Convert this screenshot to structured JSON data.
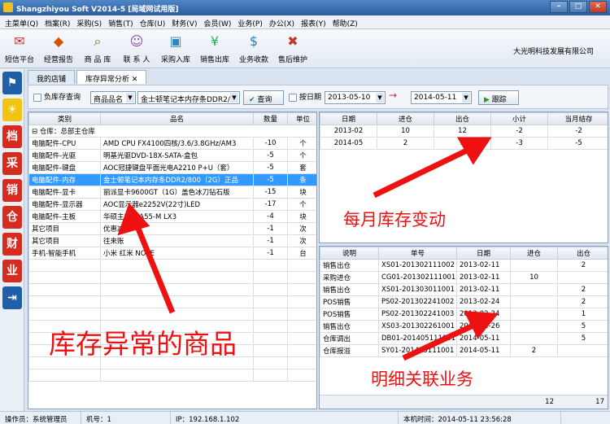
{
  "title": "Shangzhiyou Soft V2014-5 [局域网试用版]",
  "menu": [
    "主菜单(Q)",
    "档案(R)",
    "采购(S)",
    "销售(T)",
    "仓库(U)",
    "财务(V)",
    "会员(W)",
    "业务(P)",
    "办公(X)",
    "报表(Y)",
    "帮助(Z)"
  ],
  "toolbar": [
    {
      "label": "短信平台",
      "icon": "envelope-icon",
      "color": "#c0392b",
      "glyph": "✉"
    },
    {
      "label": "经营报告",
      "icon": "hat-icon",
      "color": "#d35400",
      "glyph": "◆"
    },
    {
      "label": "商 品 库",
      "icon": "magnifier-icon",
      "color": "#7f6a2a",
      "glyph": "⌕"
    },
    {
      "label": "联 系 人",
      "icon": "person-icon",
      "color": "#8e44ad",
      "glyph": "☺"
    },
    {
      "label": "采购入库",
      "icon": "box-icon",
      "color": "#2e86c1",
      "glyph": "▣"
    },
    {
      "label": "销售出库",
      "icon": "money-icon",
      "color": "#27ae60",
      "glyph": "¥"
    },
    {
      "label": "业务收款",
      "icon": "dollar-icon",
      "color": "#2980b9",
      "glyph": "$"
    },
    {
      "label": "售后维护",
      "icon": "tools-icon",
      "color": "#c0392b",
      "glyph": "✖"
    }
  ],
  "company": "大光明科技发展有限公司",
  "sidebar": [
    {
      "icon": "flag-icon",
      "color": "#1f5fa8",
      "glyph": "⚑"
    },
    {
      "icon": "bulb-icon",
      "color": "#f1c40f",
      "glyph": "☀"
    },
    {
      "icon": "archive-icon",
      "color": "#d62b1f",
      "glyph": "档"
    },
    {
      "icon": "purchase-icon",
      "color": "#d62b1f",
      "glyph": "采"
    },
    {
      "icon": "sales-icon",
      "color": "#d62b1f",
      "glyph": "销"
    },
    {
      "icon": "warehouse-icon",
      "color": "#d62b1f",
      "glyph": "仓"
    },
    {
      "icon": "finance-icon",
      "color": "#d62b1f",
      "glyph": "财"
    },
    {
      "icon": "business-icon",
      "color": "#d62b1f",
      "glyph": "业"
    },
    {
      "icon": "exit-icon",
      "color": "#1f5fa8",
      "glyph": "⇥"
    }
  ],
  "tabs": [
    "我的店铺",
    "库存异常分析"
  ],
  "query": {
    "neg_stock": "负库存查询",
    "field": "商品品名",
    "product": "金士顿笔记本内存条DDR2/8",
    "search": "查询",
    "by_date": "按日期",
    "date_from": "2013-05-10",
    "date_to": "2014-05-11",
    "track": "跟踪"
  },
  "products": {
    "headers": [
      "类别",
      "品名",
      "数量",
      "单位"
    ],
    "group": "仓库：总部主仓库",
    "rows": [
      [
        "电脑配件-CPU",
        "AMD CPU FX4100四核/3.6/3.8GHz/AM3",
        "-10",
        "个"
      ],
      [
        "电脑配件-光驱",
        "明基光驱DVD-18X-SATA-盒包",
        "-5",
        "个"
      ],
      [
        "电脑配件-键盘",
        "AOC冠捷键盘平面光电A2210 P+U（套）",
        "-5",
        "套"
      ],
      [
        "电脑配件-内存",
        "金士顿笔记本内存条DDR2/800（2G）正品",
        "-5",
        "条"
      ],
      [
        "电脑配件-显卡",
        "丽派显卡9600GT（1G）盖色冰刀钻石版",
        "-15",
        "块"
      ],
      [
        "电脑配件-显示器",
        "AOC显示器e2252V(22寸)LED",
        "-17",
        "个"
      ],
      [
        "电脑配件-主板",
        "华硕主板F1A55-M LX3",
        "-4",
        "块"
      ],
      [
        "其它项目",
        "优惠减免",
        "-1",
        "次"
      ],
      [
        "其它项目",
        "往来账",
        "-1",
        "次"
      ],
      [
        "手机-智能手机",
        "小米 红米 NOTE",
        "-1",
        "台"
      ]
    ]
  },
  "monthly": {
    "headers": [
      "日期",
      "进仓",
      "出仓",
      "小计",
      "当月结存"
    ],
    "rows": [
      [
        "2013-02",
        "10",
        "12",
        "-2",
        "-2"
      ],
      [
        "2014-05",
        "2",
        "5",
        "-3",
        "-5"
      ]
    ]
  },
  "details": {
    "headers": [
      "说明",
      "单号",
      "日期",
      "进仓",
      "出仓"
    ],
    "rows": [
      [
        "销售出仓",
        "XS01-201302111002",
        "2013-02-11",
        "",
        "2"
      ],
      [
        "采购进仓",
        "CG01-201302111001",
        "2013-02-11",
        "10",
        ""
      ],
      [
        "销售出仓",
        "XS01-201303011001",
        "2013-02-11",
        "",
        "2"
      ],
      [
        "POS销售",
        "PS02-201302241002",
        "2013-02-24",
        "",
        "2"
      ],
      [
        "POS销售",
        "PS02-201302241003",
        "2013-02-24",
        "",
        "1"
      ],
      [
        "销售出仓",
        "XS03-201302261001",
        "2013-02-26",
        "",
        "5"
      ],
      [
        "仓库调出",
        "DB01-201405111001",
        "2014-05-11",
        "",
        "5"
      ],
      [
        "仓库报溢",
        "SY01-201405111001",
        "2014-05-11",
        "2",
        ""
      ]
    ],
    "totals": [
      "12",
      "17"
    ]
  },
  "annotations": {
    "monthly": "每月库存变动",
    "abnormal": "库存异常的商品",
    "detail": "明细关联业务"
  },
  "status": {
    "operator": "操作员：系统管理员",
    "machine": "机号：1",
    "ip": "IP：192.168.1.102",
    "time": "本机时间：2014-05-11 23:56:28"
  }
}
